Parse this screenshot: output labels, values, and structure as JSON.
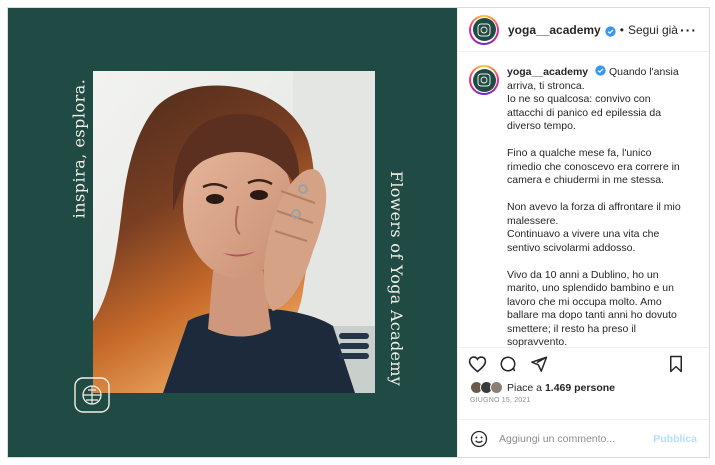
{
  "post": {
    "image": {
      "text_left": "inspira, esplora.",
      "text_right": "Flowers of Yoga Academy",
      "background_color": "#1f4b44",
      "text_color": "#f2efe6"
    },
    "header": {
      "username": "yoga__academy",
      "separator": "•",
      "follow_label": "Segui già",
      "more_icon": "more-horizontal-icon"
    },
    "caption": {
      "username": "yoga__academy",
      "first_line": "Quando l'ansia",
      "lines": [
        "arriva, ti stronca.",
        "Io ne so qualcosa: convivo con",
        "attacchi di panico ed epilessia da",
        "diverso tempo.",
        "",
        "Fino a qualche mese fa, l'unico",
        "rimedio che conoscevo era correre in",
        "camera e chiudermi in me stessa.",
        "",
        "Non avevo la forza di affrontare il mio",
        "malessere.",
        "Continuavo a vivere una vita che",
        "sentivo scivolarmi addosso.",
        "",
        "Vivo da 10 anni a Dublino, ho un",
        "marito, uno splendido bambino e un",
        "lavoro che mi occupa molto. Amo",
        "ballare ma dopo tanti anni ho dovuto",
        "smettere; il resto ha preso il",
        "sopravvento."
      ]
    },
    "actions": {
      "like_icon": "heart-icon",
      "comment_icon": "comment-icon",
      "share_icon": "send-icon",
      "save_icon": "bookmark-icon"
    },
    "likes": {
      "prefix": "Piace a ",
      "count": "1.469 persone"
    },
    "date": "GIUGNO 15, 2021",
    "add_comment": {
      "placeholder": "Aggiungi un commento...",
      "publish_label": "Pubblica",
      "emoji_icon": "emoji-icon"
    }
  },
  "colors": {
    "verified": "#3897f0",
    "publish_disabled": "#b2dffc",
    "muted": "#8e8e8e"
  }
}
